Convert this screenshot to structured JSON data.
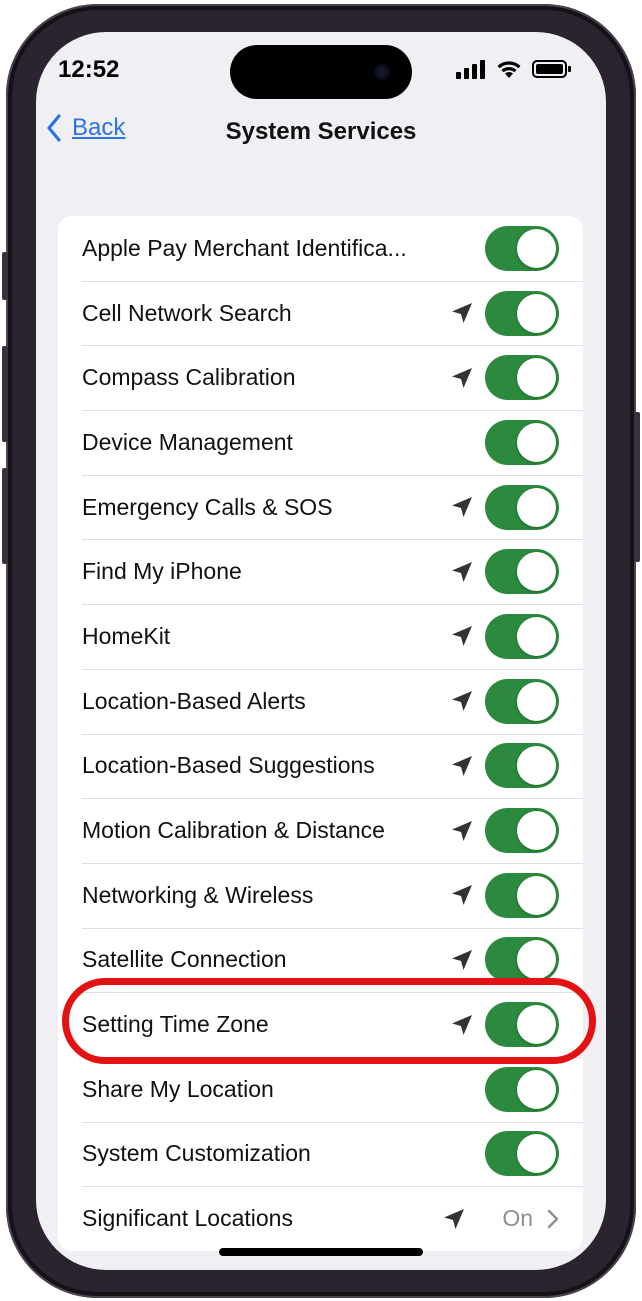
{
  "status_bar": {
    "time": "12:52"
  },
  "nav": {
    "back_label": "Back",
    "title": "System Services"
  },
  "colors": {
    "accent": "#2d73e3",
    "toggle_on": "#2b8a3e",
    "highlight": "#e41212"
  },
  "services": [
    {
      "label": "Apple Pay Merchant Identifica...",
      "location_icon": false,
      "toggle_on": true
    },
    {
      "label": "Cell Network Search",
      "location_icon": true,
      "toggle_on": true
    },
    {
      "label": "Compass Calibration",
      "location_icon": true,
      "toggle_on": true
    },
    {
      "label": "Device Management",
      "location_icon": false,
      "toggle_on": true
    },
    {
      "label": "Emergency Calls & SOS",
      "location_icon": true,
      "toggle_on": true
    },
    {
      "label": "Find My iPhone",
      "location_icon": true,
      "toggle_on": true
    },
    {
      "label": "HomeKit",
      "location_icon": true,
      "toggle_on": true
    },
    {
      "label": "Location-Based Alerts",
      "location_icon": true,
      "toggle_on": true
    },
    {
      "label": "Location-Based Suggestions",
      "location_icon": true,
      "toggle_on": true
    },
    {
      "label": "Motion Calibration & Distance",
      "location_icon": true,
      "toggle_on": true
    },
    {
      "label": "Networking & Wireless",
      "location_icon": true,
      "toggle_on": true
    },
    {
      "label": "Satellite Connection",
      "location_icon": true,
      "toggle_on": true
    },
    {
      "label": "Setting Time Zone",
      "location_icon": true,
      "toggle_on": true,
      "highlighted": true
    },
    {
      "label": "Share My Location",
      "location_icon": false,
      "toggle_on": true
    },
    {
      "label": "System Customization",
      "location_icon": false,
      "toggle_on": true
    },
    {
      "label": "Significant Locations",
      "location_icon": true,
      "value": "On",
      "chevron": true
    }
  ]
}
